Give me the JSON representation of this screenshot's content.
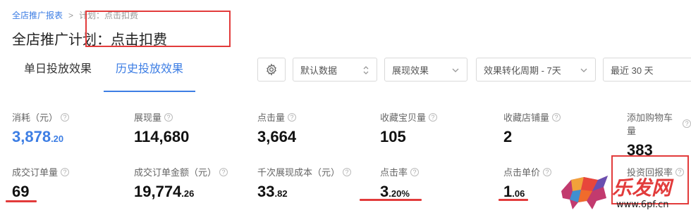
{
  "breadcrumb": {
    "root": "全店推广报表",
    "separator": ">",
    "current": "计划：点击扣费"
  },
  "page_title": "全店推广计划：点击扣费",
  "tabs": [
    {
      "label": "单日投放效果",
      "active": false
    },
    {
      "label": "历史投放效果",
      "active": true
    }
  ],
  "toolbar": {
    "settings_icon": "gear-icon",
    "data_select": "默认数据",
    "effect_select": "展现效果",
    "period_select": "效果转化周期 - 7天",
    "range_select": "最近 30 天"
  },
  "metrics_row1": [
    {
      "label": "消耗（元）",
      "value_main": "3,878",
      "value_small": ".20",
      "highlight": true
    },
    {
      "label": "展现量",
      "value_main": "114,680",
      "value_small": ""
    },
    {
      "label": "点击量",
      "value_main": "3,664",
      "value_small": ""
    },
    {
      "label": "收藏宝贝量",
      "value_main": "105",
      "value_small": ""
    },
    {
      "label": "收藏店铺量",
      "value_main": "2",
      "value_small": ""
    },
    {
      "label": "添加购物车量",
      "value_main": "383",
      "value_small": ""
    }
  ],
  "metrics_row2": [
    {
      "label": "成交订单量",
      "value_main": "69",
      "value_small": ""
    },
    {
      "label": "成交订单金额（元）",
      "value_main": "19,774",
      "value_small": ".26"
    },
    {
      "label": "千次展现成本（元）",
      "value_main": "33",
      "value_small": ".82"
    },
    {
      "label": "点击率",
      "value_main": "3",
      "value_small": ".20%"
    },
    {
      "label": "点击单价",
      "value_main": "1",
      "value_small": ".06"
    },
    {
      "label": "投资回报率",
      "value_main": "",
      "value_small": ""
    }
  ],
  "watermark": {
    "text": "乐发网",
    "url": "www.6pf.cn"
  },
  "colors": {
    "accent": "#3d7ee4",
    "annotation": "#e23b3b"
  }
}
